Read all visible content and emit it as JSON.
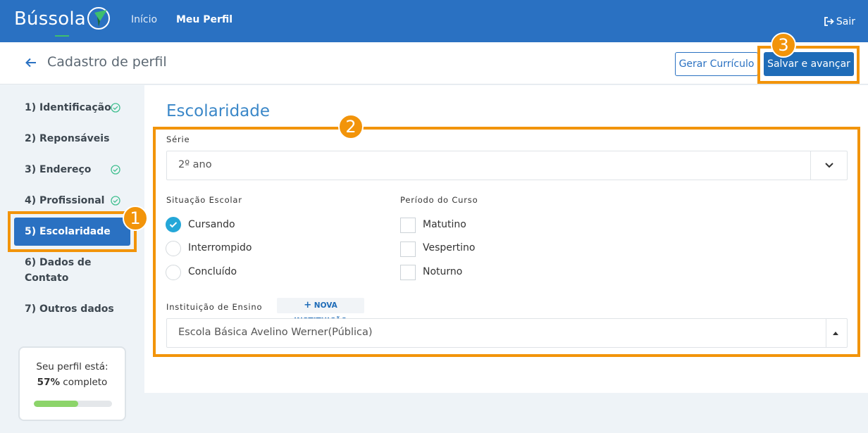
{
  "topbar": {
    "logo_text": "Bússola",
    "nav": [
      {
        "label": "Início"
      },
      {
        "label": "Meu Perfil"
      }
    ],
    "logout_label": "Sair"
  },
  "header": {
    "title": "Cadastro de perfil",
    "generate_cv_label": "Gerar Currículo",
    "save_label": "Salvar e avançar"
  },
  "sidebar": {
    "steps": [
      {
        "label": "1) Identificação",
        "completed": true
      },
      {
        "label": "2) Reponsáveis",
        "completed": false
      },
      {
        "label": "3) Endereço",
        "completed": true
      },
      {
        "label": "4) Profissional",
        "completed": true
      },
      {
        "label": "5) Escolaridade",
        "active": true
      },
      {
        "label": "6) Dados de Contato",
        "line1": "6) Dados de",
        "line2": "Contato"
      },
      {
        "label": "7) Outros dados"
      }
    ],
    "progress": {
      "line1": "Seu perfil está:",
      "percent_text": "57%",
      "suffix": " completo",
      "fraction": 0.57
    }
  },
  "form": {
    "section_title": "Escolaridade",
    "serie": {
      "label": "Série",
      "value": "2º ano"
    },
    "situacao": {
      "label": "Situação Escolar",
      "options": [
        {
          "label": "Cursando",
          "selected": true
        },
        {
          "label": "Interrompido",
          "selected": false
        },
        {
          "label": "Concluído",
          "selected": false
        }
      ]
    },
    "periodo": {
      "label": "Período do Curso",
      "options": [
        {
          "label": "Matutino",
          "checked": false
        },
        {
          "label": "Vespertino",
          "checked": false
        },
        {
          "label": "Noturno",
          "checked": false
        }
      ]
    },
    "instituicao": {
      "label": "Instituição de Ensino",
      "new_button_label": "NOVA INSTITUIÇÃO",
      "value": "Escola Básica Avelino Werner(Pública)"
    }
  },
  "callouts": [
    "1",
    "2",
    "3"
  ],
  "colors": {
    "brand_blue": "#2a71c2",
    "accent_teal": "#25a7d8",
    "highlight_orange": "#f2940a",
    "progress_green": "#8cd46a",
    "check_green": "#3fbf8f"
  }
}
